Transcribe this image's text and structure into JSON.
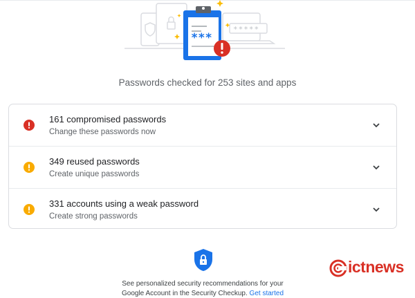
{
  "summary": {
    "text": "Passwords checked for 253 sites and apps"
  },
  "illustration": {
    "masked_password": "***",
    "masked_field": "*****"
  },
  "issues": [
    {
      "title": "161 compromised passwords",
      "subtitle": "Change these passwords now",
      "severity": "error",
      "color": "#d93025"
    },
    {
      "title": "349 reused passwords",
      "subtitle": "Create unique passwords",
      "severity": "warning",
      "color": "#f9ab00"
    },
    {
      "title": "331 accounts using a weak password",
      "subtitle": "Create strong passwords",
      "severity": "warning",
      "color": "#f9ab00"
    }
  ],
  "footer": {
    "line1": "See personalized security recommendations for your",
    "line2_prefix": "Google Account in the Security Checkup.",
    "link": "Get started"
  },
  "watermark": {
    "text": "ictnews",
    "color": "#d93025"
  },
  "colors": {
    "accent": "#1a73e8",
    "error": "#d93025",
    "warning": "#f9ab00"
  }
}
